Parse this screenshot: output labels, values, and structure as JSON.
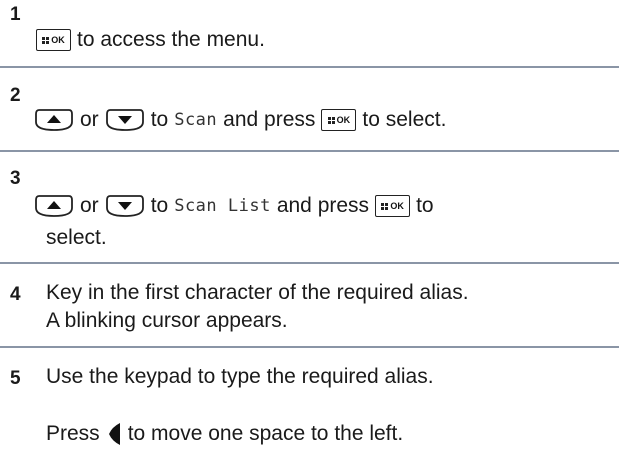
{
  "keys": {
    "ok_label": "OK"
  },
  "steps": [
    {
      "number": "1",
      "text1": "to access the menu."
    },
    {
      "number": "2",
      "or": "or",
      "to": "to",
      "menu_item": "Scan",
      "mid": "and press",
      "end": "to select."
    },
    {
      "number": "3",
      "or": "or",
      "to": "to",
      "menu_item": "Scan List",
      "mid": "and press",
      "end": "to",
      "cont": "select."
    },
    {
      "number": "4",
      "line1": "Key in the first character of the required alias.",
      "line2": "A blinking cursor appears."
    },
    {
      "number": "5",
      "line1": "Use the keypad to type the required alias.",
      "press": "Press",
      "line2_end": "to move one space to the left."
    }
  ]
}
